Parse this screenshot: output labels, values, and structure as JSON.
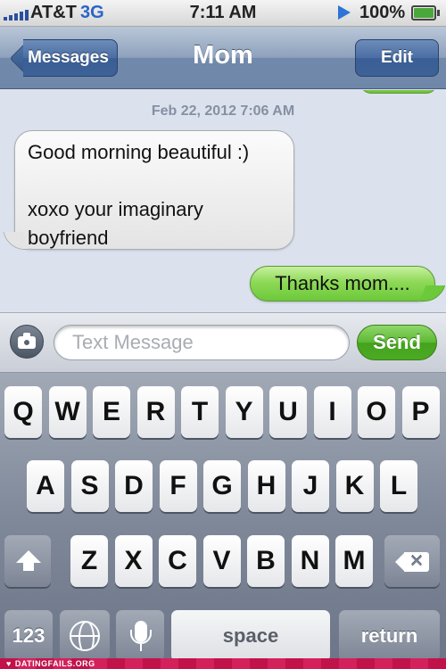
{
  "status_bar": {
    "carrier": "AT&T",
    "network": "3G",
    "time": "7:11 AM",
    "battery_percent": "100%",
    "battery_level": 1.0,
    "signal_icon": "signal-bars-icon",
    "location_icon": "location-arrow-icon"
  },
  "nav": {
    "back_label": "Messages",
    "title": "Mom",
    "edit_label": "Edit"
  },
  "conversation": {
    "timestamp": "Feb 22, 2012 7:06 AM",
    "messages": [
      {
        "direction": "incoming",
        "text": "Good morning beautiful :)\n\nxoxo your imaginary\nboyfriend"
      },
      {
        "direction": "outgoing",
        "text": "Thanks mom...."
      }
    ]
  },
  "composer": {
    "placeholder": "Text Message",
    "value": "",
    "send_label": "Send",
    "camera_icon": "camera-icon"
  },
  "keyboard": {
    "row1": [
      "Q",
      "W",
      "E",
      "R",
      "T",
      "Y",
      "U",
      "I",
      "O",
      "P"
    ],
    "row2": [
      "A",
      "S",
      "D",
      "F",
      "G",
      "H",
      "J",
      "K",
      "L"
    ],
    "row3": [
      "Z",
      "X",
      "C",
      "V",
      "B",
      "N",
      "M"
    ],
    "numbers_label": "123",
    "space_label": "space",
    "return_label": "return",
    "shift_icon": "shift-arrow-icon",
    "delete_icon": "delete-backspace-icon",
    "globe_icon": "globe-icon",
    "mic_icon": "microphone-icon"
  },
  "watermark": {
    "text": "DATINGFAILS.ORG"
  },
  "colors": {
    "incoming_bubble": "#e8e8e8",
    "outgoing_bubble": "#8ed957",
    "nav_bar": "#8ea1bc",
    "send_button": "#5cb733"
  }
}
